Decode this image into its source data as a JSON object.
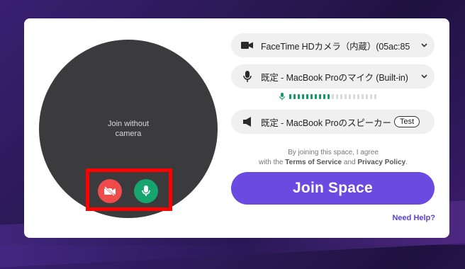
{
  "preview": {
    "line1": "Join without",
    "line2": "camera"
  },
  "controls": {
    "camera_icon": "camera-off-icon",
    "mic_icon": "microphone-icon",
    "highlight_color": "#ff0000"
  },
  "devices": {
    "camera": {
      "icon": "video-camera-icon",
      "label": "FaceTime HDカメラ（内蔵）(05ac:85"
    },
    "microphone": {
      "icon": "microphone-icon",
      "label": "既定 - MacBook Proのマイク (Built-in)"
    },
    "mic_level": {
      "active_bars": 10,
      "total_bars": 21
    },
    "speaker": {
      "icon": "speaker-icon",
      "label": "既定 - MacBook Proのスピーカー",
      "test_label": "Test"
    }
  },
  "agreement": {
    "line1": "By joining this space, I agree",
    "prefix": "with the ",
    "terms": "Terms of Service",
    "and": " and ",
    "privacy": "Privacy Policy",
    "suffix": "."
  },
  "join_button": "Join Space",
  "help_link": "Need Help?",
  "colors": {
    "accent": "#6a4ae0",
    "camera_off": "#ef4b4b",
    "mic_on": "#16a56f"
  }
}
